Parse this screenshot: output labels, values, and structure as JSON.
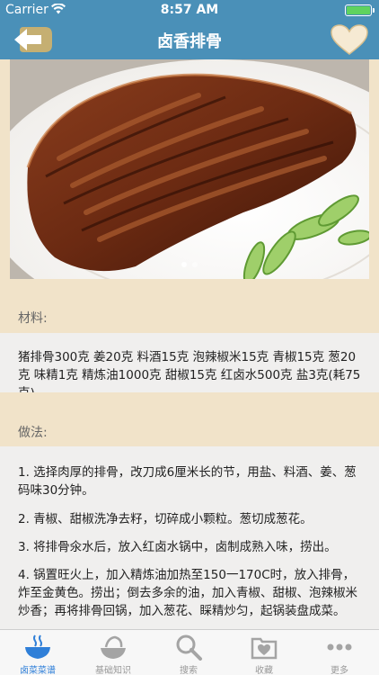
{
  "status_bar": {
    "carrier": "Carrier",
    "time": "8:57 AM"
  },
  "nav": {
    "title": "卤香排骨"
  },
  "ingredients": {
    "label": "材料:",
    "text": "猪排骨300克 姜20克 料酒15克 泡辣椒米15克 青椒15克 葱20克 味精1克 精炼油1000克 甜椒15克 红卤水500克 盐3克(耗75克)"
  },
  "method": {
    "label": "做法:",
    "steps": [
      "1. 选择肉厚的排骨，改刀成6厘米长的节，用盐、料酒、姜、葱码味30分钟。",
      "2. 青椒、甜椒洗净去籽，切碎成小颗粒。葱切成葱花。",
      "3. 将排骨氽水后，放入红卤水锅中，卤制成熟入味，捞出。",
      "4. 锅置旺火上，加入精炼油加热至150一170C时，放入排骨，炸至金黄色。捞出；倒去多余的油，加入青椒、甜椒、泡辣椒米炒香；再将排骨回锅，加入葱花、睬精炒匀，起锅装盘成菜。"
    ]
  },
  "tabs": [
    {
      "label": "卤菜菜谱",
      "icon": "bowl-icon",
      "active": true
    },
    {
      "label": "基础知识",
      "icon": "ingredients-icon",
      "active": false
    },
    {
      "label": "搜索",
      "icon": "search-icon",
      "active": false
    },
    {
      "label": "收藏",
      "icon": "favorites-icon",
      "active": false
    },
    {
      "label": "更多",
      "icon": "more-icon",
      "active": false
    }
  ],
  "colors": {
    "nav": "#4a90b8",
    "active_tab": "#2f7fd8",
    "background": "#f1e3c9"
  }
}
